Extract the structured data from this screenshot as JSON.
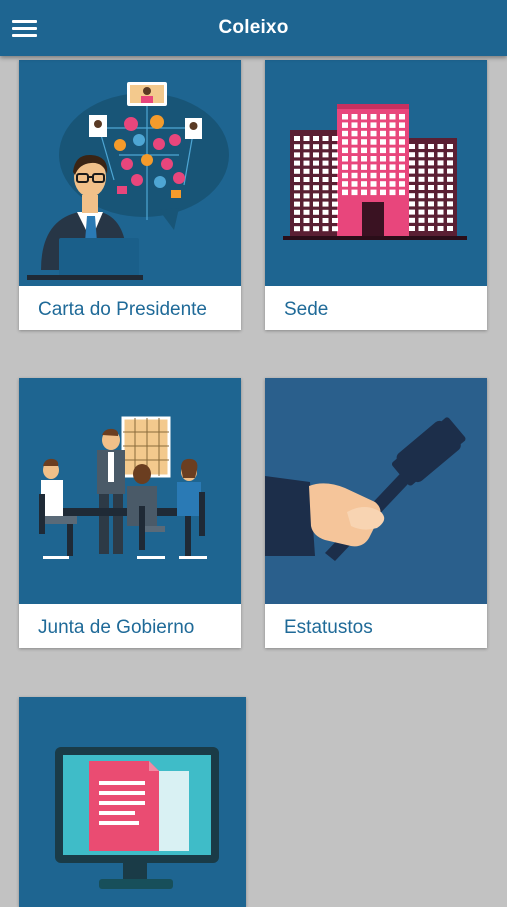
{
  "app": {
    "title": "Coleixo"
  },
  "cards": [
    {
      "label": "Carta do Presidente",
      "icon": "president-letter-illustration"
    },
    {
      "label": "Sede",
      "icon": "headquarters-building-illustration"
    },
    {
      "label": "Junta de Gobierno",
      "icon": "board-meeting-illustration"
    },
    {
      "label": "Estatustos",
      "icon": "gavel-hand-illustration"
    },
    {
      "label": "",
      "icon": "document-monitor-illustration"
    }
  ],
  "colors": {
    "appbar": "#1e6591",
    "card_art_bg": "#1e6591",
    "page_bg": "#c2c2c2",
    "label_text": "#1f6a98",
    "accent_pink": "#e8467c"
  }
}
